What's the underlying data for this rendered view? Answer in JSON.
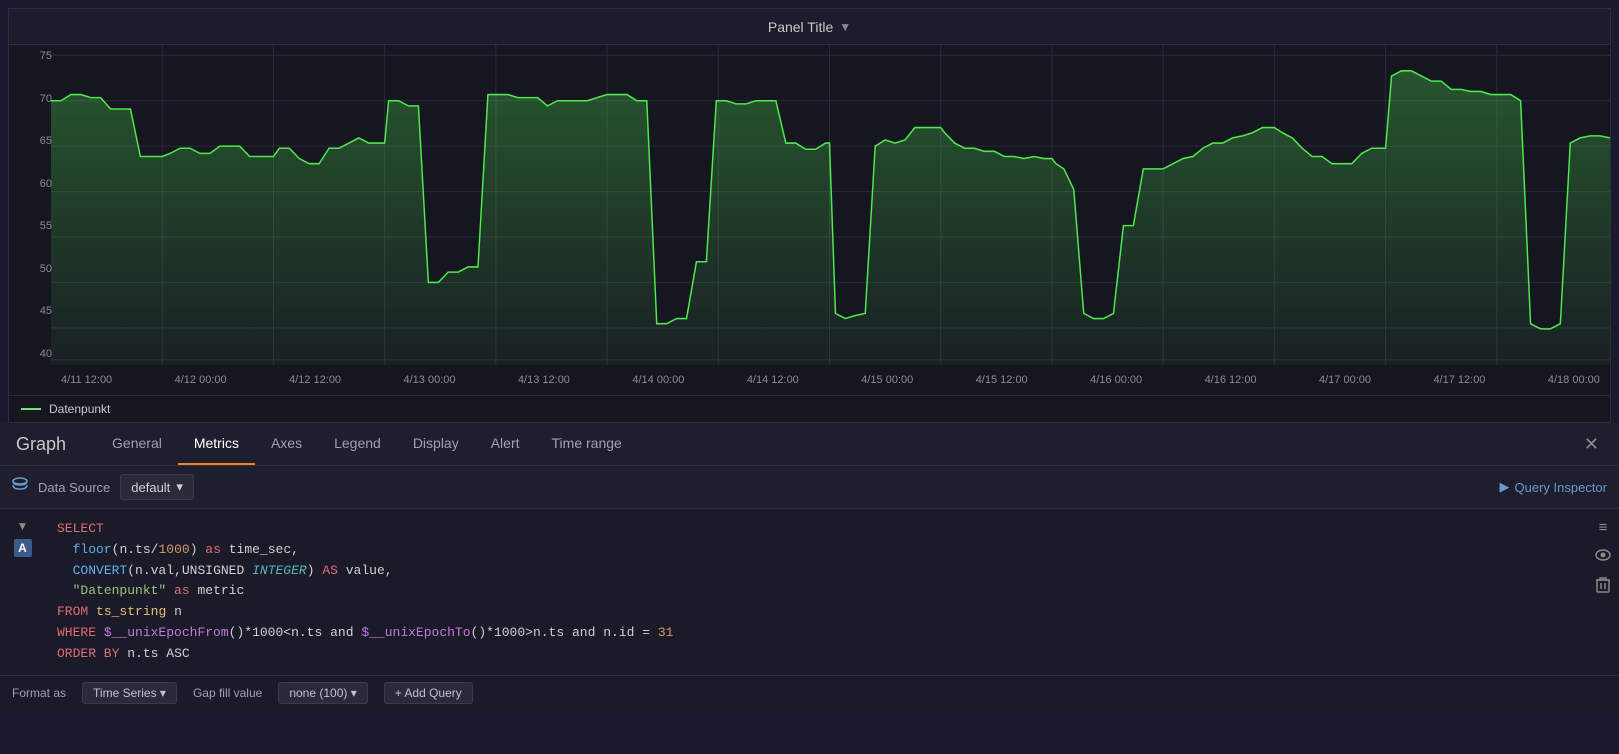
{
  "panel": {
    "title": "Panel Title",
    "title_arrow": "▼"
  },
  "chart": {
    "y_labels": [
      "75",
      "70",
      "65",
      "60",
      "55",
      "50",
      "45",
      "40"
    ],
    "x_labels": [
      "4/11 12:00",
      "4/12 00:00",
      "4/12 12:00",
      "4/13 00:00",
      "4/13 12:00",
      "4/14 00:00",
      "4/14 12:00",
      "4/15 00:00",
      "4/15 12:00",
      "4/16 00:00",
      "4/16 12:00",
      "4/17 00:00",
      "4/17 12:00",
      "4/18 00:00"
    ],
    "legend": "Datenpunkt"
  },
  "tabs": {
    "panel_label": "Graph",
    "items": [
      {
        "label": "General",
        "active": false
      },
      {
        "label": "Metrics",
        "active": true
      },
      {
        "label": "Axes",
        "active": false
      },
      {
        "label": "Legend",
        "active": false
      },
      {
        "label": "Display",
        "active": false
      },
      {
        "label": "Alert",
        "active": false
      },
      {
        "label": "Time range",
        "active": false
      }
    ]
  },
  "datasource": {
    "label": "Data Source",
    "value": "default"
  },
  "query_inspector": {
    "label": "Query Inspector"
  },
  "query": {
    "badge": "A",
    "code_lines": [
      "SELECT",
      "  floor(n.ts/1000) as time_sec,",
      "  CONVERT(n.val,UNSIGNED INTEGER) AS value,",
      "  \"Datenpunkt\" as metric",
      "FROM ts_string n",
      "WHERE $__unixEpochFrom()*1000<n.ts and $__unixEpochTo()*1000>n.ts and n.id = 31",
      "ORDER BY n.ts ASC"
    ]
  },
  "bottom_options": {
    "format_label": "Format as",
    "format_value": "Time Series",
    "gap_fill_label": "Gap fill value",
    "gap_fill_value": "none (100)",
    "add_query_label": "Add Query"
  },
  "icons": {
    "db": "🗄",
    "collapse": "▼",
    "menu": "≡",
    "eye": "👁",
    "trash": "🗑",
    "arrow_right": "▶"
  }
}
